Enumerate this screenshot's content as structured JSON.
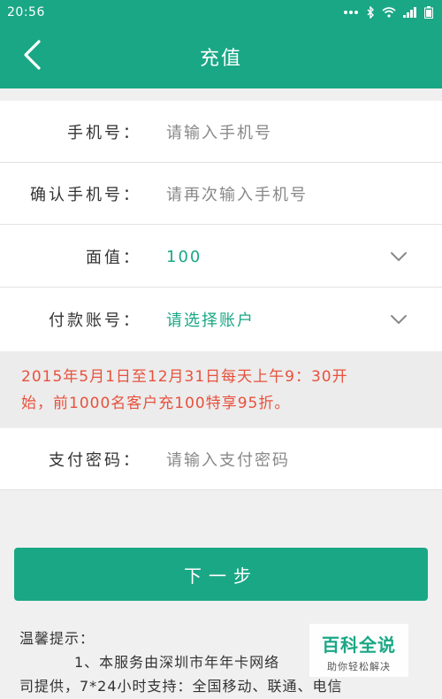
{
  "status_bar": {
    "time": "20:56",
    "icons": [
      "dots-icon",
      "bluetooth-icon",
      "wifi-icon",
      "signal-icon",
      "battery-icon"
    ]
  },
  "nav": {
    "title": "充值",
    "back_icon": "chevron-left-icon"
  },
  "form": {
    "phone": {
      "label": "手机号：",
      "placeholder": "请输入手机号"
    },
    "confirm_phone": {
      "label": "确认手机号：",
      "placeholder": "请再次输入手机号"
    },
    "amount": {
      "label": "面值：",
      "value": "100"
    },
    "account": {
      "label": "付款账号：",
      "value": "请选择账户"
    },
    "password": {
      "label": "支付密码：",
      "placeholder": "请输入支付密码"
    }
  },
  "promo": {
    "line1": "2015年5月1日至12月31日每天上午9：30开",
    "line2": "始，前1000名客户充100特享95折。"
  },
  "next_button": {
    "label": "下一步"
  },
  "tips": {
    "title": "温馨提示：",
    "line1": "1、本服务由深圳市年年卡网络",
    "line2": "司提供，7*24小时支持：全国移动、联通、电信"
  },
  "watermark": {
    "title": "百科全说",
    "subtitle": "助你轻松解决"
  },
  "colors": {
    "primary": "#1aa785",
    "promo": "#e8513d"
  }
}
